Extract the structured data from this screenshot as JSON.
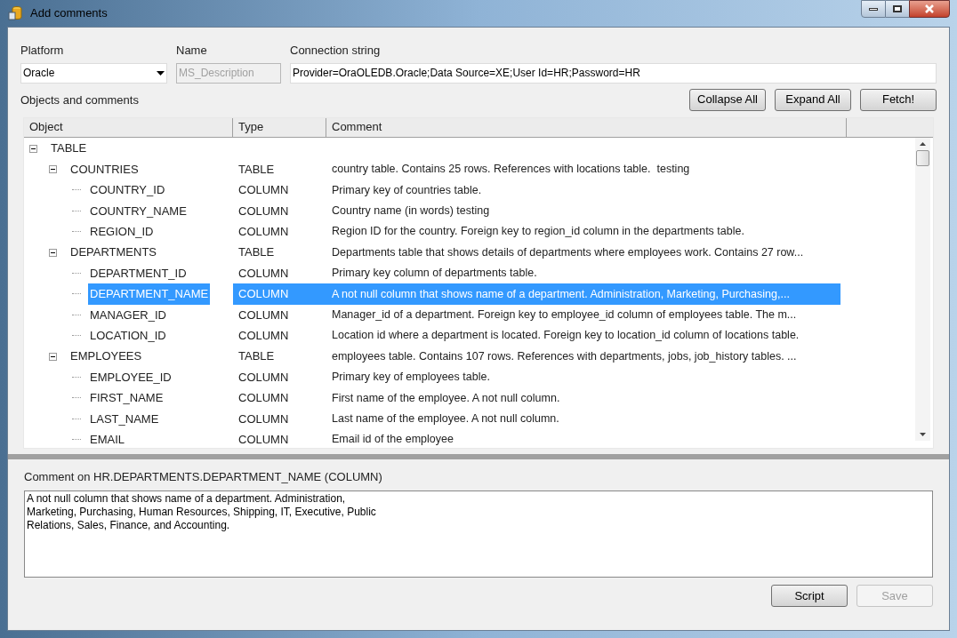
{
  "window": {
    "title": "Add comments"
  },
  "platform": {
    "label": "Platform",
    "value": "Oracle"
  },
  "name": {
    "label": "Name",
    "value": "MS_Description",
    "disabled": true
  },
  "connection": {
    "label": "Connection string",
    "value": "Provider=OraOLEDB.Oracle;Data Source=XE;User Id=HR;Password=HR"
  },
  "objects_label": "Objects and comments",
  "toolbar_buttons": [
    {
      "label": "Collapse All",
      "disabled": false
    },
    {
      "label": "Expand All",
      "disabled": false
    },
    {
      "label": "Fetch!",
      "disabled": false
    }
  ],
  "tree": {
    "columns": [
      "Object",
      "Type",
      "Comment"
    ],
    "rows": [
      {
        "name": "TABLE",
        "expanded": true,
        "selected": false,
        "children": [
          {
            "name": "COUNTRIES",
            "type": "TABLE",
            "comment": "country table. Contains 25 rows. References with locations table.  testing",
            "expanded": true,
            "selected": false,
            "children": [
              {
                "name": "COUNTRY_ID",
                "type": "COLUMN",
                "comment": "Primary key of countries table.",
                "selected": false
              },
              {
                "name": "COUNTRY_NAME",
                "type": "COLUMN",
                "comment": "Country name (in words) testing",
                "selected": false
              },
              {
                "name": "REGION_ID",
                "type": "COLUMN",
                "comment": "Region ID for the country. Foreign key to region_id column in the departments table.",
                "selected": false
              }
            ]
          },
          {
            "name": "DEPARTMENTS",
            "type": "TABLE",
            "comment": "Departments table that shows details of departments where employees work. Contains 27 row...",
            "expanded": true,
            "selected": false,
            "children": [
              {
                "name": "DEPARTMENT_ID",
                "type": "COLUMN",
                "comment": "Primary key column of departments table.",
                "selected": false
              },
              {
                "name": "DEPARTMENT_NAME",
                "type": "COLUMN",
                "comment": "A not null column that shows name of a department. Administration, Marketing, Purchasing,...",
                "selected": true
              },
              {
                "name": "MANAGER_ID",
                "type": "COLUMN",
                "comment": "Manager_id of a department. Foreign key to employee_id column of employees table. The m...",
                "selected": false
              },
              {
                "name": "LOCATION_ID",
                "type": "COLUMN",
                "comment": "Location id where a department is located. Foreign key to location_id column of locations table.",
                "selected": false
              }
            ]
          },
          {
            "name": "EMPLOYEES",
            "type": "TABLE",
            "comment": "employees table. Contains 107 rows. References with departments, jobs, job_history tables. ...",
            "expanded": true,
            "selected": false,
            "children": [
              {
                "name": "EMPLOYEE_ID",
                "type": "COLUMN",
                "comment": "Primary key of employees table.",
                "selected": false
              },
              {
                "name": "FIRST_NAME",
                "type": "COLUMN",
                "comment": "First name of the employee. A not null column.",
                "selected": false
              },
              {
                "name": "LAST_NAME",
                "type": "COLUMN",
                "comment": "Last name of the employee. A not null column.",
                "selected": false
              },
              {
                "name": "EMAIL",
                "type": "COLUMN",
                "comment": "Email id of the employee",
                "selected": false
              }
            ]
          }
        ]
      }
    ]
  },
  "comment_panel": {
    "label": "Comment on HR.DEPARTMENTS.DEPARTMENT_NAME (COLUMN)",
    "text": "A not null column that shows name of a department. Administration,\nMarketing, Purchasing, Human Resources, Shipping, IT, Executive, Public\nRelations, Sales, Finance, and Accounting."
  },
  "bottom_buttons": [
    {
      "label": "Script",
      "disabled": false
    },
    {
      "label": "Save",
      "disabled": true
    }
  ]
}
